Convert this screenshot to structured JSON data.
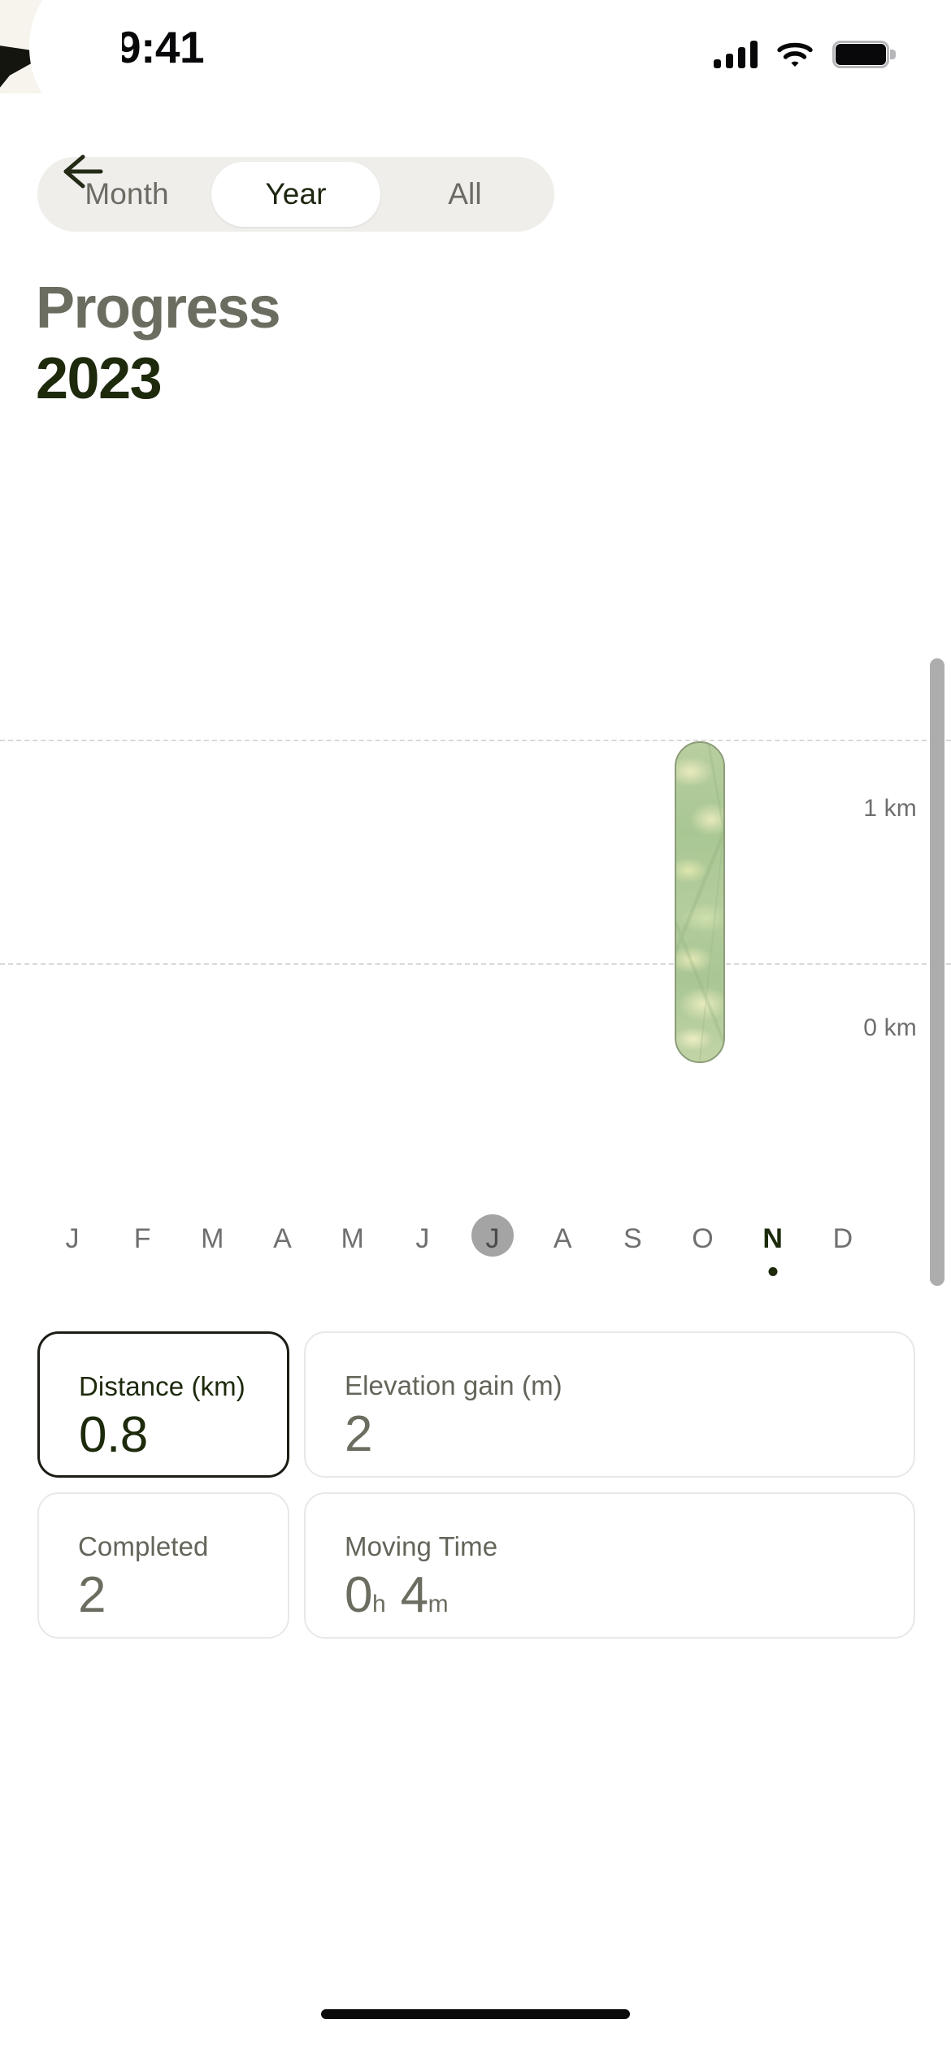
{
  "status_bar": {
    "time": "9:41",
    "cellular_icon": "cellular-signal-icon",
    "wifi_icon": "wifi-icon",
    "battery_icon": "battery-full-icon"
  },
  "nav": {
    "back_icon": "back-arrow-icon"
  },
  "segmented_control": {
    "options": [
      {
        "label": "Month",
        "selected": false
      },
      {
        "label": "Year",
        "selected": true
      },
      {
        "label": "All",
        "selected": false
      }
    ]
  },
  "header": {
    "title": "Progress",
    "year": "2023",
    "title_color": "#6b6d60",
    "year_color": "#1d2a0c"
  },
  "chart_data": {
    "type": "bar",
    "title": "Progress 2023",
    "xlabel": "",
    "ylabel": "km",
    "ylim": [
      -0.85,
      1.2
    ],
    "grid": true,
    "gridlines": [
      1,
      0
    ],
    "tick_labels": [
      "1 km",
      "0 km"
    ],
    "categories": [
      "J",
      "F",
      "M",
      "A",
      "M",
      "J",
      "J",
      "A",
      "S",
      "O",
      "N",
      "D"
    ],
    "category_full": [
      "January",
      "February",
      "March",
      "April",
      "May",
      "June",
      "July",
      "August",
      "September",
      "October",
      "November",
      "December"
    ],
    "values": [
      0,
      0,
      0,
      0,
      0,
      0,
      0,
      0,
      0,
      0,
      0.8,
      0
    ],
    "highlighted_category": "J",
    "highlighted_index": 6,
    "current_category": "N",
    "current_index": 10,
    "bar_color": "#aec894",
    "bar_border_color": "#8c9c79",
    "gridline_color": "#d9d9d5",
    "axis_label_color": "#6e6e6e"
  },
  "scrollbar": {
    "name": "chart-scrollbar"
  },
  "stats": [
    {
      "label": "Distance (km)",
      "value": "0.8",
      "selected": true
    },
    {
      "label": "Elevation gain (m)",
      "value": "2",
      "selected": false
    },
    {
      "label": "Completed",
      "value": "2",
      "selected": false
    }
  ],
  "moving_time": {
    "label": "Moving Time",
    "hours": "0",
    "hours_unit": "h",
    "minutes": "4",
    "minutes_unit": "m"
  },
  "home_indicator": {
    "name": "home-indicator"
  }
}
